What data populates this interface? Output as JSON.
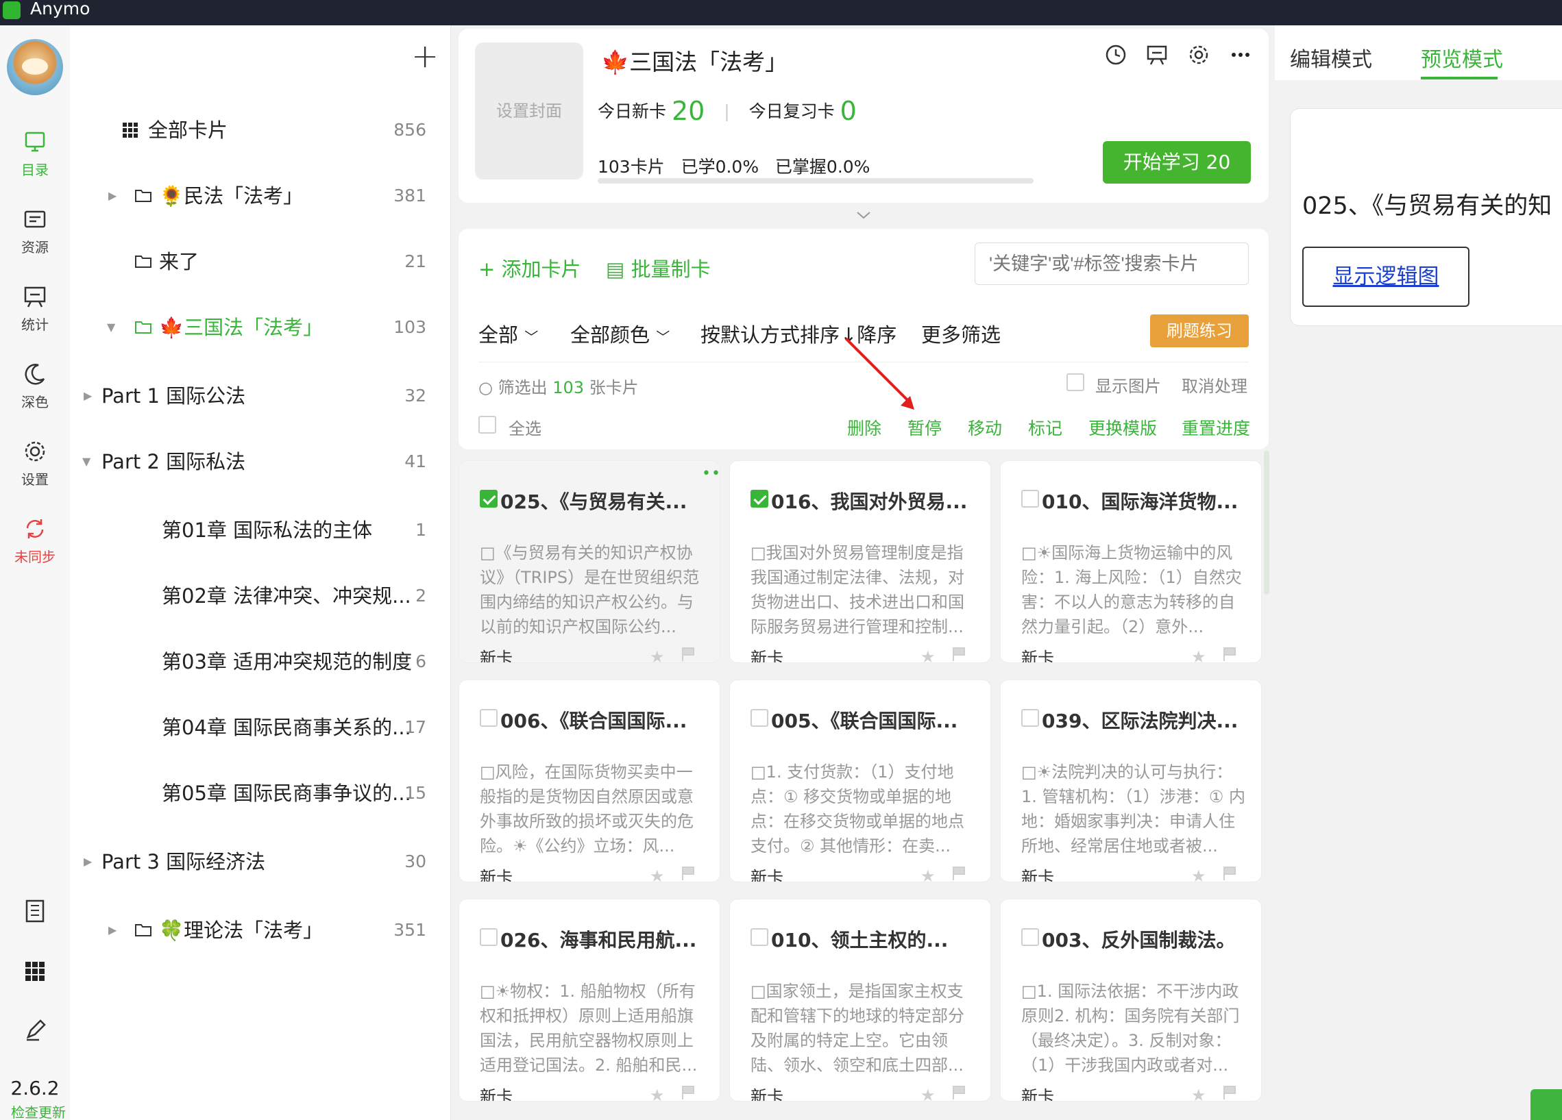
{
  "app": {
    "name": "Anymo"
  },
  "rail": {
    "items": [
      {
        "label": "目录",
        "icon": "catalog-icon"
      },
      {
        "label": "资源",
        "icon": "resources-icon"
      },
      {
        "label": "统计",
        "icon": "stats-icon"
      },
      {
        "label": "深色",
        "icon": "moon-icon"
      },
      {
        "label": "设置",
        "icon": "gear-icon"
      },
      {
        "label": "未同步",
        "icon": "sync-icon"
      }
    ],
    "version": "2.6.2",
    "update": "检查更新"
  },
  "tree": {
    "rows": [
      {
        "name": "全部卡片",
        "count": "856"
      },
      {
        "name": "民法「法考」",
        "count": "381"
      },
      {
        "name": "来了",
        "count": "21"
      },
      {
        "name": "三国法「法考」",
        "count": "103"
      },
      {
        "name": "Part 1 国际公法",
        "count": "32"
      },
      {
        "name": "Part 2 国际私法",
        "count": "41"
      },
      {
        "name": "第01章 国际私法的主体",
        "count": "1"
      },
      {
        "name": "第02章 法律冲突、冲突规...",
        "count": "2"
      },
      {
        "name": "第03章 适用冲突规范的制度",
        "count": "6"
      },
      {
        "name": "第04章 国际民商事关系的...",
        "count": "17"
      },
      {
        "name": "第05章 国际民商事争议的...",
        "count": "15"
      },
      {
        "name": "Part 3 国际经济法",
        "count": "30"
      },
      {
        "name": "理论法「法考」",
        "count": "351"
      }
    ]
  },
  "deck": {
    "cover": "设置封面",
    "title": "三国法「法考」",
    "new_label": "今日新卡",
    "new_count": "20",
    "review_label": "今日复习卡",
    "review_count": "0",
    "cards": "103卡片",
    "learned": "已学0.0%",
    "mastered": "已掌握0.0%",
    "progress": 0.0,
    "start": "开始学习 20"
  },
  "toolbar": {
    "add": "+ 添加卡片",
    "batch": "批量制卡",
    "search_placeholder": "'关键字'或'#标签'搜索卡片",
    "filter_all": "全部",
    "filter_color": "全部颜色",
    "sort": "按默认方式排序",
    "order": "↓降序",
    "more": "更多筛选",
    "practice": "刷题练习",
    "filtered_prefix": "筛选出",
    "filtered_count": "103",
    "filtered_suffix": "张卡片",
    "show_images": "显示图片",
    "cancel": "取消处理",
    "select_all": "全选",
    "actions": [
      "删除",
      "暂停",
      "移动",
      "标记",
      "更换模版",
      "重置进度"
    ]
  },
  "cards": [
    {
      "title": "025、《与贸易有关...",
      "body": "□《与贸易有关的知识产权协议》（TRIPS）是在世贸组织范围内缔结的知识产权公约。与以前的知识产权国际公约...",
      "status": "新卡",
      "checked": true
    },
    {
      "title": "016、我国对外贸易...",
      "body": "□我国对外贸易管理制度是指我国通过制定法律、法规，对货物进出口、技术进出口和国际服务贸易进行管理和控制...",
      "status": "新卡",
      "checked": true
    },
    {
      "title": "010、国际海洋货物...",
      "body": "□☀国际海上货物运输中的风险：1. 海上风险：（1）自然灾害：不以人的意志为转移的自然力量引起。（2）意外...",
      "status": "新卡",
      "checked": false
    },
    {
      "title": "006、《联合国国际...",
      "body": "□风险，在国际货物买卖中一般指的是货物因自然原因或意外事故所致的损坏或灭失的危险。☀《公约》立场：风...",
      "status": "新卡",
      "checked": false
    },
    {
      "title": "005、《联合国国际...",
      "body": "□1. 支付货款：（1）支付地点：① 移交货物或单据的地点：在移交货物或单据的地点支付。② 其他情形：在卖...",
      "status": "新卡",
      "checked": false
    },
    {
      "title": "039、区际法院判决...",
      "body": "□☀法院判决的认可与执行：1. 管辖机构：（1）涉港：① 内地：婚姻家事判决：申请人住所地、经常居住地或者被...",
      "status": "新卡",
      "checked": false
    },
    {
      "title": "026、海事和民用航...",
      "body": "□☀物权：1. 船舶物权（所有权和抵押权）原则上适用船旗国法，民用航空器物权原则上适用登记国法。2. 船舶和民...",
      "status": "新卡",
      "checked": false
    },
    {
      "title": "010、领土主权的...",
      "body": "□国家领土，是指国家主权支配和管辖下的地球的特定部分及附属的特定上空。它由领陆、领水、领空和底土四部...",
      "status": "新卡",
      "checked": false
    },
    {
      "title": "003、反外国制裁法。",
      "body": "□1. 国际法依据：不干涉内政原则2. 机构：国务院有关部门（最终决定）。3. 反制对象：（1）干涉我国内政或者对...",
      "status": "新卡",
      "checked": false
    }
  ],
  "right": {
    "tab_edit": "编辑模式",
    "tab_preview": "预览模式",
    "preview_title": "025、《与贸易有关的知",
    "logic_button": "显示逻辑图"
  },
  "colors": {
    "accent": "#39b53a",
    "practice": "#e8a03a",
    "alert": "#e94040"
  }
}
